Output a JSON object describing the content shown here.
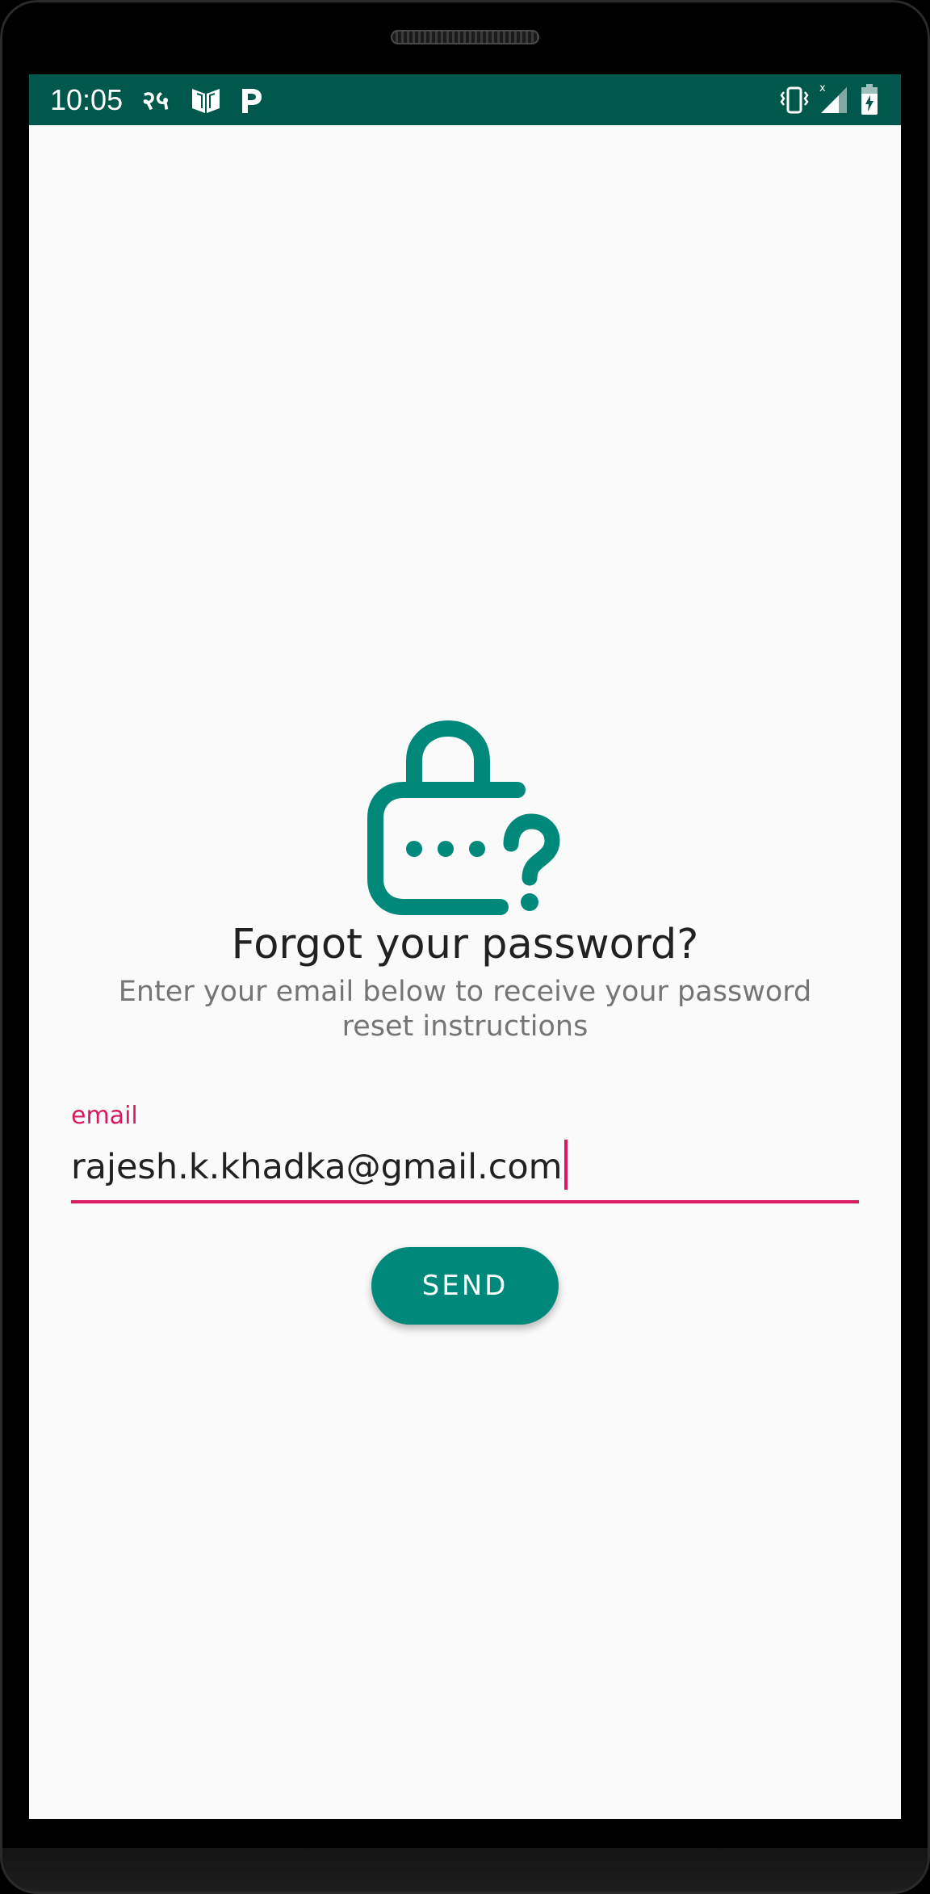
{
  "status_bar": {
    "time": "10:05",
    "notification_text": "२५",
    "icons": [
      "book-icon",
      "p-app-icon",
      "vibrate-icon",
      "signal-icon",
      "battery-charging-icon"
    ],
    "background_color": "#00574b"
  },
  "forgot_password": {
    "illustration": "lock-question-icon",
    "title": "Forgot your password?",
    "subtitle": "Enter your email below to receive your password reset instructions",
    "email_label": "email",
    "email_value": "rajesh.k.khadka@gmail.com",
    "send_label": "SEND"
  },
  "colors": {
    "primary": "#00897b",
    "primary_dark": "#00574b",
    "accent": "#d81b60",
    "background": "#fafafa"
  }
}
